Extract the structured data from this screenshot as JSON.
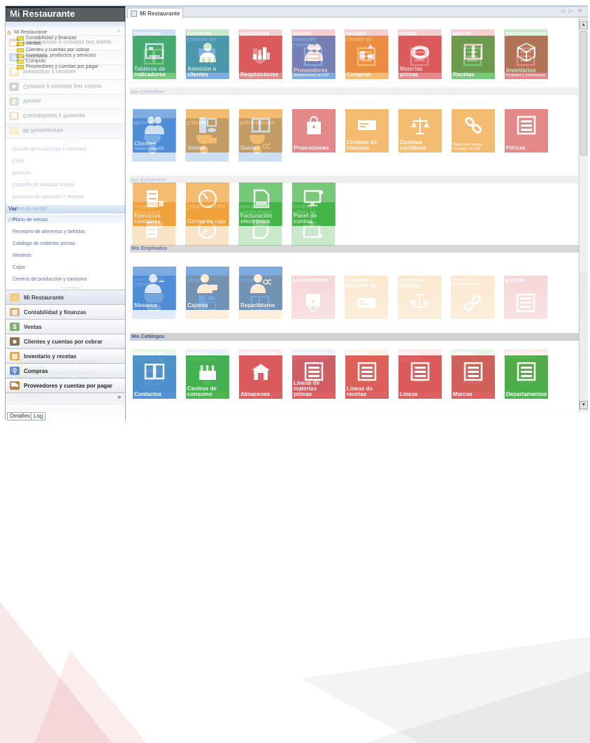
{
  "colors": {
    "green": "#43b446",
    "blue": "#4f8ed6",
    "red": "#db5a5c",
    "orange": "#f0a23a"
  },
  "left": {
    "title": "Mi Restaurante",
    "tree": {
      "root": "Mi Restaurante",
      "children": [
        "Contabilidad y finanzas",
        "Ventas",
        "Clientes y cuentas por cobrar",
        "Inventario, productos y servicios",
        "Compras",
        "Proveedores y cuentas por pagar"
      ]
    },
    "ver_label": "Ver",
    "ver_links": [
      "Plano de mesas",
      "Recetario de alimentos y bebidas",
      "Catálogo de materias primas",
      "Meseros",
      "Cajas",
      "Centros de producción y consumo"
    ],
    "nav": [
      {
        "label": "Mi Restaurante",
        "icon": "house-icon"
      },
      {
        "label": "Contabilidad y finanzas",
        "icon": "ledger-icon"
      },
      {
        "label": "Ventas",
        "icon": "cash-icon"
      },
      {
        "label": "Clientes y cuentas por cobrar",
        "icon": "customers-icon"
      },
      {
        "label": "Inventario y recetas",
        "icon": "inventory-icon"
      },
      {
        "label": "Compras",
        "icon": "cart-icon"
      },
      {
        "label": "Proveedores y cuentas por pagar",
        "icon": "supplier-icon"
      }
    ],
    "bottom_tabs": [
      "Detalles",
      "Log"
    ]
  },
  "right": {
    "tab_label": "Mi Restaurante",
    "window_controls": "◁ ▷ ✕",
    "sections": {
      "empleados": "Mis Empleados",
      "catalogos": "Mis Catálogos"
    },
    "tiles_main": [
      {
        "label": "Tableros de indicadores",
        "sub": "",
        "color": "green",
        "icon": "dashboard-icon"
      },
      {
        "label": "Atención a clientes",
        "sub": "",
        "color": "blue",
        "icon": "person-icon"
      },
      {
        "label": "Requisiciones",
        "sub": "",
        "color": "red",
        "icon": "requisition-icon"
      },
      {
        "label": "Proveedores",
        "sub": "Administración de CxP",
        "color": "blue",
        "icon": "suppliers-icon"
      },
      {
        "label": "Compras",
        "sub": "",
        "color": "orange",
        "icon": "coins-icon"
      },
      {
        "label": "Materias primas",
        "sub": "",
        "color": "red",
        "icon": "plate-icon"
      },
      {
        "label": "Recetas",
        "sub": "",
        "color": "green",
        "icon": "book-icon"
      },
      {
        "label": "Inventarios",
        "sub": "Productos y movimientos",
        "color": "red",
        "icon": "boxes-icon"
      },
      {
        "label": "Clientes",
        "sub": "Gestión y cobranza",
        "color": "blue",
        "icon": "group-icon"
      },
      {
        "label": "Ventas",
        "sub": "",
        "color": "orange",
        "icon": "sales-icon"
      },
      {
        "label": "Gastos",
        "sub": "",
        "color": "orange",
        "icon": "wallet-icon"
      },
      {
        "label": "Promociones",
        "sub": "",
        "color": "red",
        "icon": "bag-icon"
      },
      {
        "label": "Cuentas de cheques",
        "sub": "",
        "color": "orange",
        "icon": "check-icon"
      },
      {
        "label": "Cuentas contables",
        "sub": "",
        "color": "orange",
        "icon": "scale-icon"
      },
      {
        "label": "",
        "sub": "Relacionar cuentas contables del SAT",
        "color": "orange",
        "icon": "link-icon"
      },
      {
        "label": "Pólizas",
        "sub": "",
        "color": "red",
        "icon": "form-icon"
      },
      {
        "label": "Ejercicios contables",
        "sub": "",
        "color": "orange",
        "icon": "cabinet-icon"
      },
      {
        "label": "Cortes de caja",
        "sub": "",
        "color": "orange",
        "icon": "clock-icon"
      },
      {
        "label": "Facturación electrónica",
        "sub": "",
        "color": "green",
        "icon": "cfdi-icon"
      },
      {
        "label": "Panel de control",
        "sub": "",
        "color": "green",
        "icon": "monitor-icon"
      }
    ],
    "tiles_empleados": [
      {
        "label": "Meseros",
        "color": "blue",
        "icon": "waiter-icon"
      },
      {
        "label": "Cajeros",
        "color": "blue",
        "icon": "cashier-icon"
      },
      {
        "label": "Repartidores",
        "color": "blue",
        "icon": "delivery-icon"
      }
    ],
    "tiles_catalogos": [
      {
        "label": "Contactos",
        "color": "blue",
        "icon": "contacts-icon"
      },
      {
        "label": "Centros de consumo",
        "color": "green",
        "icon": "factory-icon"
      },
      {
        "label": "Almacenes",
        "color": "red",
        "icon": "warehouse-icon"
      },
      {
        "label": "Líneas de materias primas",
        "color": "red",
        "icon": "form-icon"
      },
      {
        "label": "Líneas de recetas",
        "color": "red",
        "icon": "form-icon"
      },
      {
        "label": "Líneas",
        "color": "red",
        "icon": "form-icon"
      },
      {
        "label": "Marcas",
        "color": "red",
        "icon": "form-icon"
      },
      {
        "label": "Departamentos",
        "color": "green",
        "icon": "form-icon"
      }
    ],
    "dots": "..........."
  }
}
